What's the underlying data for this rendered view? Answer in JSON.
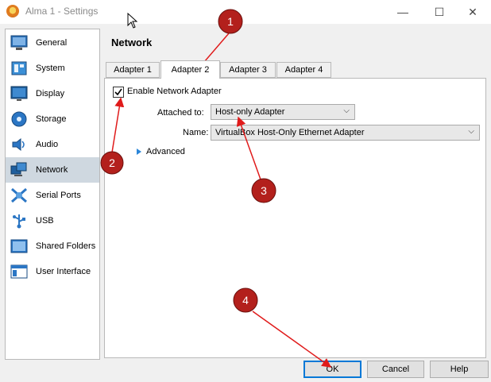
{
  "window": {
    "title": "Alma 1 - Settings",
    "controls": {
      "minimize": "—",
      "maximize": "☐",
      "close": "✕"
    }
  },
  "sidebar": {
    "items": [
      {
        "label": "General",
        "icon": "general-icon"
      },
      {
        "label": "System",
        "icon": "system-icon"
      },
      {
        "label": "Display",
        "icon": "display-icon"
      },
      {
        "label": "Storage",
        "icon": "storage-icon"
      },
      {
        "label": "Audio",
        "icon": "audio-icon"
      },
      {
        "label": "Network",
        "icon": "network-icon",
        "selected": true
      },
      {
        "label": "Serial Ports",
        "icon": "serial-ports-icon"
      },
      {
        "label": "USB",
        "icon": "usb-icon"
      },
      {
        "label": "Shared Folders",
        "icon": "shared-folders-icon"
      },
      {
        "label": "User Interface",
        "icon": "user-interface-icon"
      }
    ]
  },
  "main": {
    "section_title": "Network",
    "tabs": [
      {
        "label": "Adapter 1"
      },
      {
        "label": "Adapter 2",
        "active": true
      },
      {
        "label": "Adapter 3"
      },
      {
        "label": "Adapter 4"
      }
    ],
    "enable_label": "Enable Network Adapter",
    "enable_checked": true,
    "attached_to_label": "Attached to:",
    "attached_to_value": "Host-only Adapter",
    "name_label": "Name:",
    "name_value": "VirtualBox Host-Only Ethernet Adapter",
    "advanced_label": "Advanced"
  },
  "buttons": {
    "ok": "OK",
    "cancel": "Cancel",
    "help": "Help"
  },
  "annotations": {
    "markers": [
      "1",
      "2",
      "3",
      "4"
    ],
    "color": "#e01b1b",
    "badge_color": "#b3201c"
  }
}
